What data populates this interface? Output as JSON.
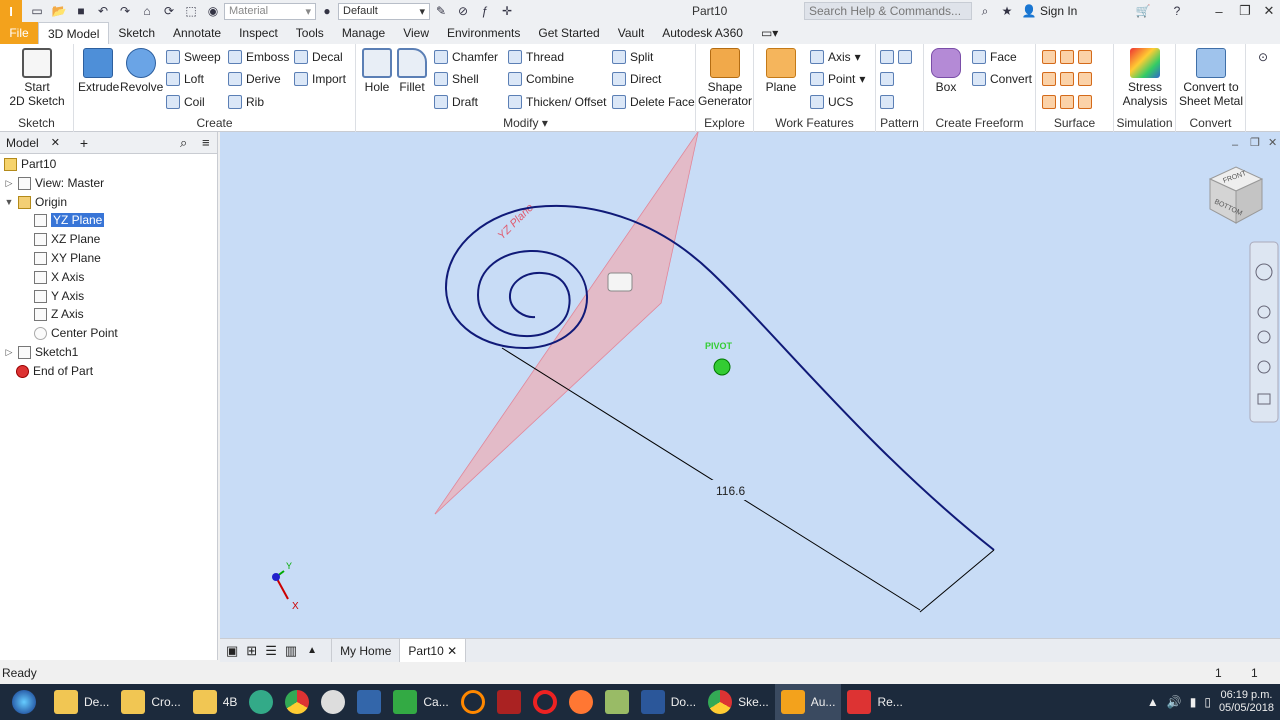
{
  "app": {
    "logo": "I",
    "document_title": "Part10",
    "material": "Material",
    "appearance": "Default",
    "search_placeholder": "Search Help & Commands...",
    "sign_in": "Sign In"
  },
  "tabs": [
    "File",
    "3D Model",
    "Sketch",
    "Annotate",
    "Inspect",
    "Tools",
    "Manage",
    "View",
    "Environments",
    "Get Started",
    "Vault",
    "Autodesk A360"
  ],
  "ribbon": {
    "sketch": {
      "start": "Start",
      "start2": "2D Sketch",
      "label": "Sketch"
    },
    "create": {
      "extrude": "Extrude",
      "revolve": "Revolve",
      "sweep": "Sweep",
      "loft": "Loft",
      "coil": "Coil",
      "emboss": "Emboss",
      "derive": "Derive",
      "rib": "Rib",
      "decal": "Decal",
      "import": "Import",
      "label": "Create"
    },
    "modify": {
      "hole": "Hole",
      "fillet": "Fillet",
      "chamfer": "Chamfer",
      "shell": "Shell",
      "draft": "Draft",
      "thread": "Thread",
      "combine": "Combine",
      "thicken": "Thicken/ Offset",
      "split": "Split",
      "direct": "Direct",
      "delete_face": "Delete Face",
      "label": "Modify"
    },
    "explore": {
      "shape": "Shape",
      "generator": "Generator",
      "label": "Explore"
    },
    "work": {
      "plane": "Plane",
      "axis": "Axis",
      "point": "Point",
      "ucs": "UCS",
      "label": "Work Features"
    },
    "pattern": {
      "label": "Pattern"
    },
    "freeform": {
      "box": "Box",
      "face": "Face",
      "convert": "Convert",
      "label": "Create Freeform"
    },
    "surface": {
      "label": "Surface"
    },
    "simulation": {
      "stress": "Stress",
      "analysis": "Analysis",
      "label": "Simulation"
    },
    "convert": {
      "c1": "Convert to",
      "c2": "Sheet Metal",
      "label": "Convert"
    }
  },
  "browser": {
    "tab": "Model",
    "items": [
      {
        "label": "Part10",
        "icon": "part-icon"
      },
      {
        "label": "View: Master",
        "icon": "view-icon"
      },
      {
        "label": "Origin",
        "icon": "folder-icon"
      },
      {
        "label": "YZ Plane",
        "icon": "plane-icon"
      },
      {
        "label": "XZ Plane",
        "icon": "plane-icon"
      },
      {
        "label": "XY Plane",
        "icon": "plane-icon"
      },
      {
        "label": "X Axis",
        "icon": "axis-icon"
      },
      {
        "label": "Y Axis",
        "icon": "axis-icon"
      },
      {
        "label": "Z Axis",
        "icon": "axis-icon"
      },
      {
        "label": "Center Point",
        "icon": "point-icon"
      },
      {
        "label": "Sketch1",
        "icon": "sketch-icon"
      },
      {
        "label": "End of Part",
        "icon": "end-icon"
      }
    ]
  },
  "viewport": {
    "dimension": "116.6",
    "plane_label": "YZ Plane",
    "pivot": "PIVOT",
    "viewcube_front": "FRONT",
    "viewcube_bottom": "BOTTOM",
    "axis_x": "X",
    "axis_y": "Y"
  },
  "doctabs": {
    "home": "My Home",
    "part": "Part10"
  },
  "status": {
    "text": "Ready",
    "n1": "1",
    "n2": "1"
  },
  "taskbar": {
    "items": [
      {
        "label": "De..."
      },
      {
        "label": "Cro..."
      },
      {
        "label": "4B"
      },
      {
        "label": "Ca..."
      },
      {
        "label": "Do..."
      },
      {
        "label": "Ske..."
      },
      {
        "label": "Au..."
      },
      {
        "label": "Re..."
      }
    ],
    "time": "06:19 p.m.",
    "date": "05/05/2018"
  },
  "colors": {
    "accent": "#f3a21c",
    "viewport": "#c8dcf6",
    "curve": "#101a78",
    "plane": "#e6b8c4"
  }
}
